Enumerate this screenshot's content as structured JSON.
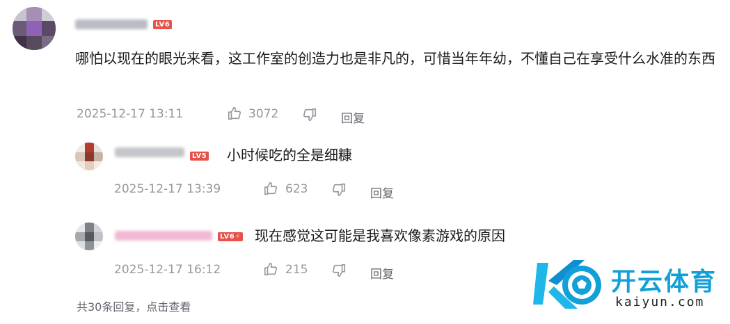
{
  "main_comment": {
    "level": "LV6",
    "text": "哪怕以现在的眼光来看，这工作室的创造力也是非凡的，可惜当年年幼，不懂自己在享受什么水准的东西",
    "date": "2025-12-17 13:11",
    "likes": "3072",
    "reply_label": "回复"
  },
  "replies": [
    {
      "level": "LV5",
      "text": "小时候吃的全是细糠",
      "date": "2025-12-17 13:39",
      "likes": "623",
      "reply_label": "回复"
    },
    {
      "level": "LV6",
      "text": "现在感觉这可能是我喜欢像素游戏的原因",
      "date": "2025-12-17 16:12",
      "likes": "215",
      "reply_label": "回复"
    }
  ],
  "more_replies": "共30条回复，点击查看",
  "watermark": {
    "brand": "开云体育",
    "url": "kaiyun.com"
  },
  "colors": {
    "text": "#18191c",
    "meta": "#9499a0",
    "level_badge": "#e8514b",
    "brand": "#12a0d8"
  }
}
